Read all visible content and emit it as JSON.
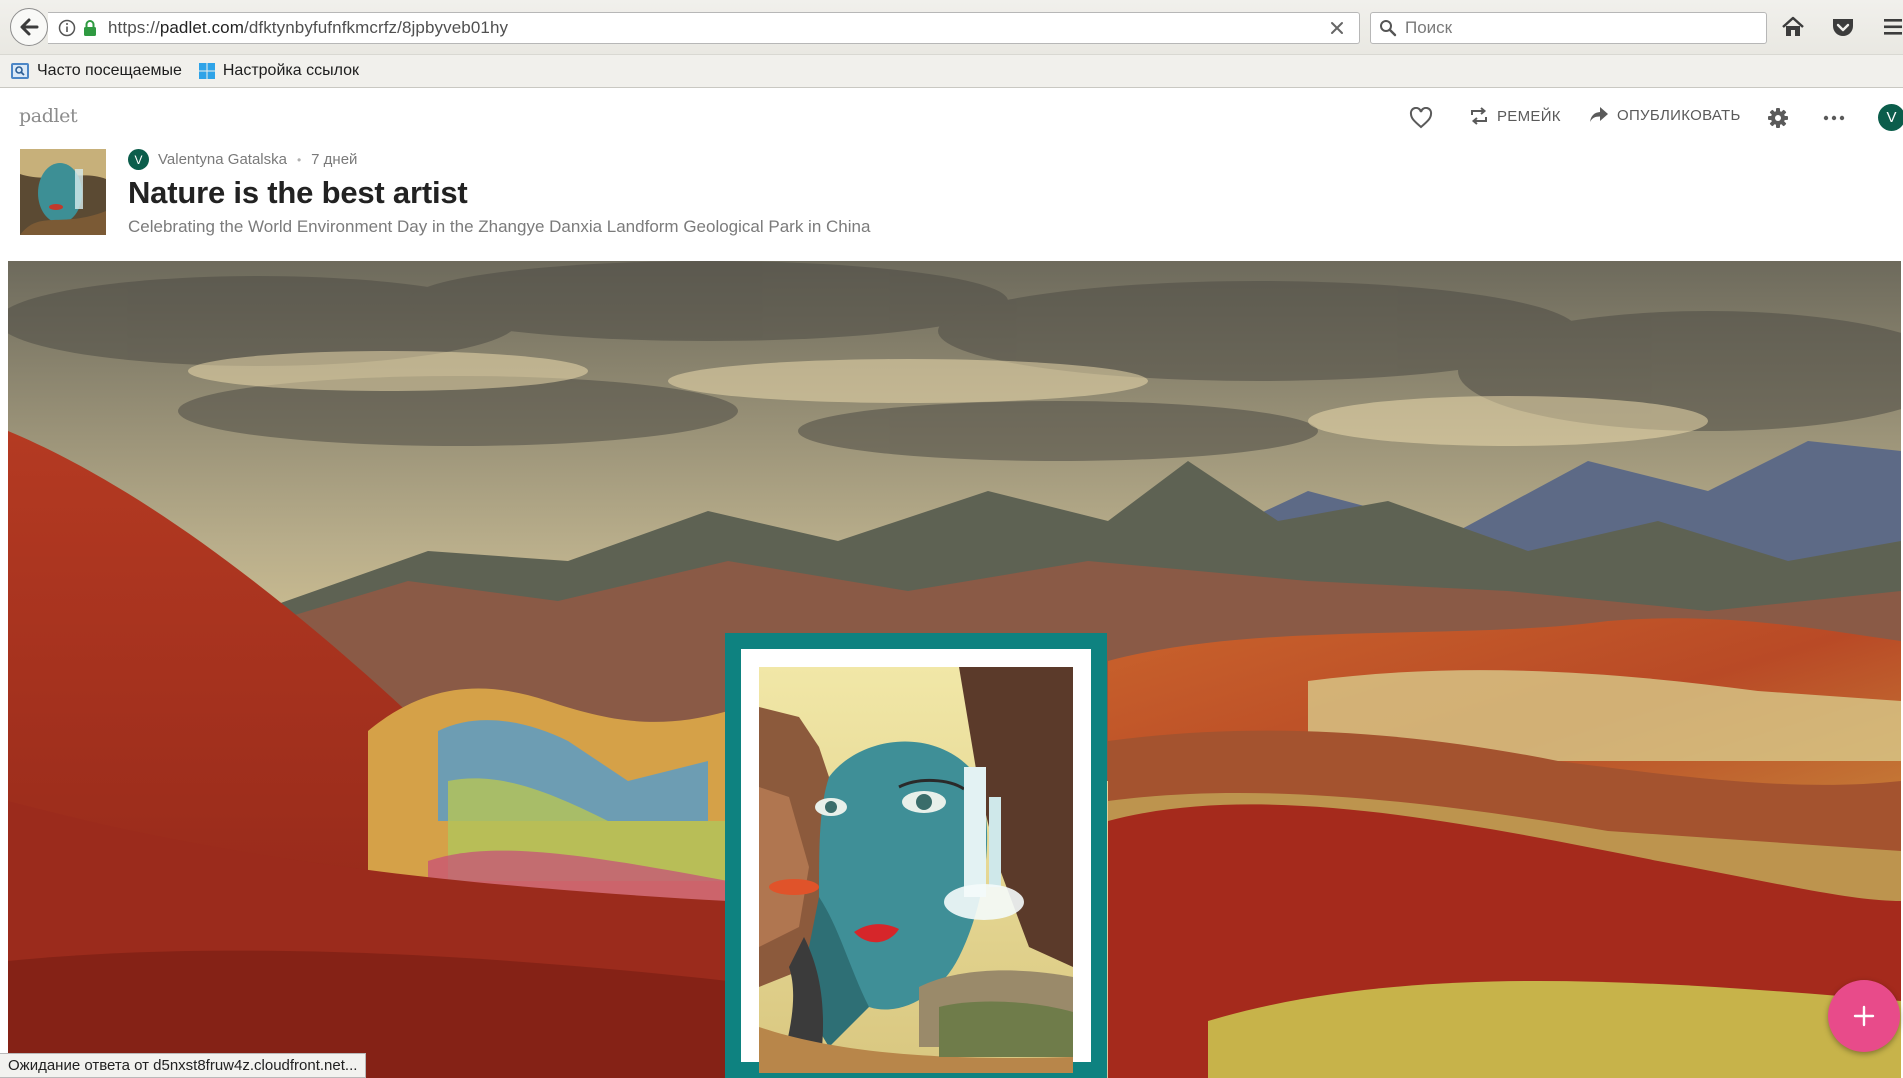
{
  "browser": {
    "url_prefix": "https://",
    "url_host": "padlet.com",
    "url_path": "/dfktynbyfufnfkmcrfz/8jpbyveb01hy",
    "search_placeholder": "Поиск",
    "bookmarks": [
      {
        "label": "Часто посещаемые",
        "icon": "frequent-sites-icon"
      },
      {
        "label": "Настройка ссылок",
        "icon": "windows-icon"
      }
    ]
  },
  "padlet": {
    "logo": "padlet",
    "toolbar": {
      "remake_label": "РЕМЕЙК",
      "publish_label": "ОПУБЛИКОВАТЬ",
      "user_initial": "V"
    },
    "wall": {
      "author_initial": "V",
      "author": "Valentyna Gatalska",
      "age": "7 дней",
      "title": "Nature is the best artist",
      "description": "Celebrating the World Environment Day in the Zhangye Danxia Landform Geological Park in China"
    }
  },
  "status_text": "Ожидание ответа от d5nxst8fruw4z.cloudfront.net...",
  "colors": {
    "post_frame": "#0e8280",
    "fab": "#e84b8a",
    "avatar": "#0b5d4b"
  }
}
